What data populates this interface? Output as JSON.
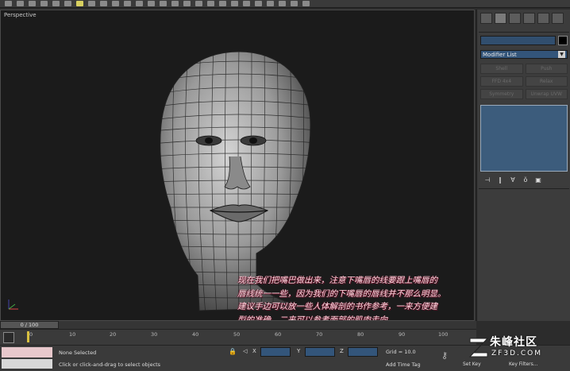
{
  "viewport": {
    "label": "Perspective"
  },
  "command_panel": {
    "modifier_list": "Modifier List",
    "buttons": [
      "Shell",
      "Push",
      "FFD 4x4",
      "Relax",
      "Symmetry",
      "Unwrap UVW"
    ]
  },
  "annotation": {
    "lines": [
      "现在我们把嘴巴做出来，注意下嘴唇的线要跟上嘴唇的",
      "唇线统一一些，因为我们的下嘴唇的唇线并不那么明显。",
      "建议手边可以放一些人体解剖的书作参考，一来方便建",
      "型的准确，二来可以参考面部的肌肉走向…"
    ]
  },
  "timeline": {
    "frame": "0 / 100",
    "ticks": [
      "0",
      "10",
      "20",
      "30",
      "40",
      "50",
      "60",
      "70",
      "80",
      "90",
      "100"
    ]
  },
  "status": {
    "selection": "None Selected",
    "prompt": "Click or click-and-drag to select objects",
    "x_label": "X",
    "y_label": "Y",
    "z_label": "Z",
    "grid": "Grid = 10.0",
    "time_tag": "Add Time Tag",
    "set_key": "Set Key",
    "key_filters": "Key Filters..."
  },
  "watermark": {
    "title": "朱峰社区",
    "subtitle": "ZF3D.COM"
  },
  "colors": {
    "viewport_bg": "#1b1b1b",
    "panel_bg": "#3c3c3c",
    "field_blue": "#33557a",
    "annotation_text": "#ffd8e0"
  }
}
